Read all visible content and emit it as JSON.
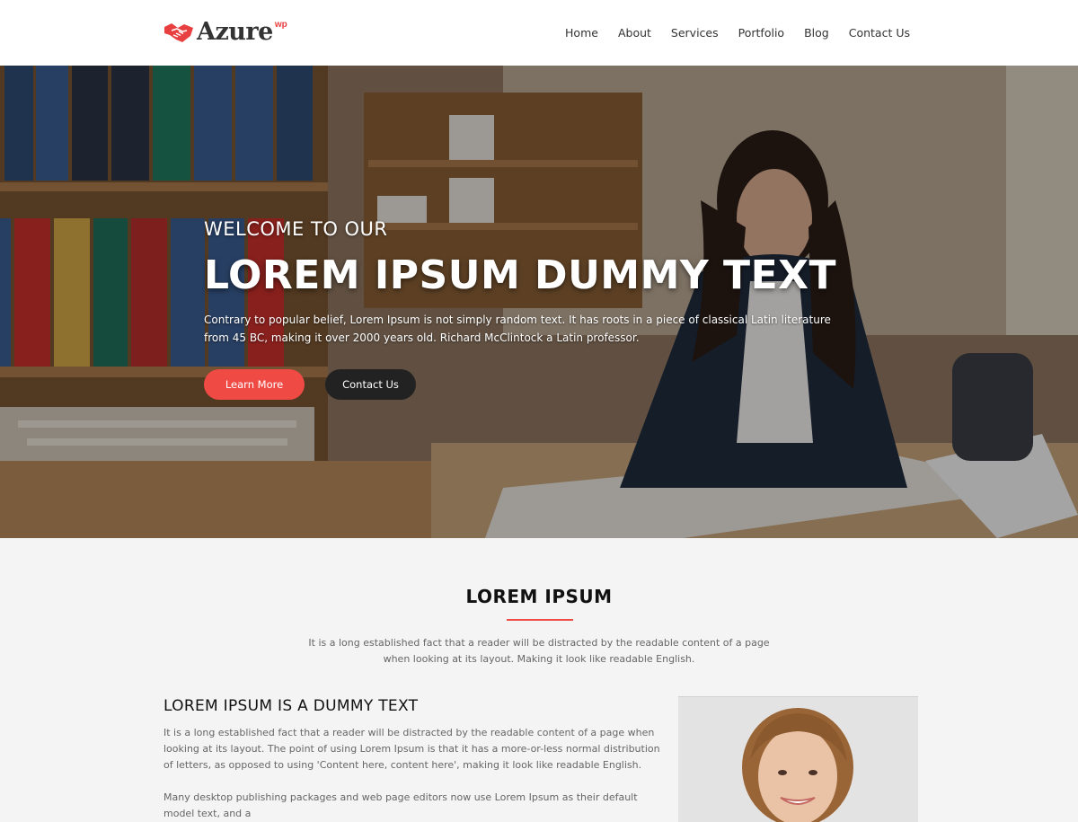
{
  "brand": {
    "name": "Azure",
    "superscript": "wp",
    "accent": "#f04a45"
  },
  "nav": {
    "items": [
      {
        "label": "Home"
      },
      {
        "label": "About"
      },
      {
        "label": "Services"
      },
      {
        "label": "Portfolio"
      },
      {
        "label": "Blog"
      },
      {
        "label": "Contact Us"
      }
    ]
  },
  "hero": {
    "kicker": "WELCOME TO OUR",
    "title": "LOREM IPSUM DUMMY TEXT",
    "description": "Contrary to popular belief, Lorem Ipsum is not simply random text. It has roots in a piece of classical Latin literature from 45 BC, making it over 2000 years old. Richard McClintock  a Latin professor.",
    "primary_button": "Learn More",
    "secondary_button": "Contact Us"
  },
  "about": {
    "title": "LOREM IPSUM",
    "subtitle": "It is a long established fact that a reader will be distracted by the readable content of a page when looking at its layout. Making it look like readable English.",
    "heading": "LOREM IPSUM IS A DUMMY TEXT",
    "paragraph1": "It is a long established fact that a reader will be distracted by the readable content of a page when looking at its layout. The point of using Lorem Ipsum is that it has a more-or-less normal distribution of letters, as opposed to using 'Content here, content here', making it look like readable English.",
    "paragraph2": "Many desktop publishing packages and web page editors now use Lorem Ipsum as their default model text, and a"
  }
}
